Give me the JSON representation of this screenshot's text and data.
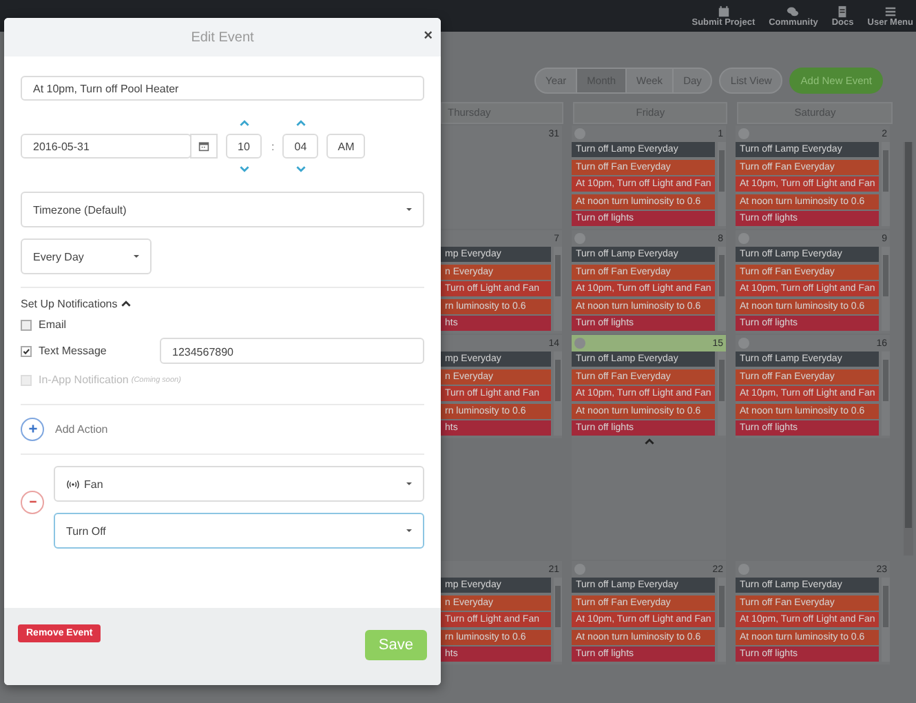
{
  "navbar": {
    "items": [
      {
        "label": "Submit Project"
      },
      {
        "label": "Community"
      },
      {
        "label": "Docs"
      },
      {
        "label": "User Menu"
      }
    ]
  },
  "views": [
    {
      "label": "Year",
      "selected": false
    },
    {
      "label": "Month",
      "selected": true
    },
    {
      "label": "Week",
      "selected": false
    },
    {
      "label": "Day",
      "selected": false
    }
  ],
  "list_view": "List View",
  "add_button": "Add New Event",
  "calendar": {
    "columns": [
      "Thursday",
      "Friday",
      "Saturday"
    ],
    "weeks": [
      {
        "days": [
          {
            "number": "31",
            "today": false
          },
          {
            "number": "1",
            "today": false,
            "badge": true,
            "events": [
              {
                "text": "Turn off Lamp Everyday",
                "color": "#3d4247"
              },
              {
                "text": "Turn off Fan Everyday",
                "color": "#b0462b"
              },
              {
                "text": "At 10pm, Turn off Light and Fan",
                "color": "#b3382f"
              },
              {
                "text": "At noon turn luminosity to 0.6",
                "color": "#ae432b"
              },
              {
                "text": "Turn off lights",
                "color": "#a3293a"
              }
            ]
          },
          {
            "number": "2",
            "today": false,
            "badge": true,
            "events": [
              {
                "text": "Turn off Lamp Everyday",
                "color": "#3d4247"
              },
              {
                "text": "Turn off Fan Everyday",
                "color": "#b0462b"
              },
              {
                "text": "At 10pm, Turn off Light and Fan",
                "color": "#b3382f"
              },
              {
                "text": "At noon turn luminosity to 0.6",
                "color": "#ae432b"
              },
              {
                "text": "Turn off lights",
                "color": "#a3293a"
              }
            ]
          }
        ]
      },
      {
        "days": [
          {
            "number": "7",
            "today": false,
            "badge": false,
            "events": [
              {
                "text": "mp Everyday",
                "color": "#3d4247"
              },
              {
                "text": "n Everyday",
                "color": "#b0462b"
              },
              {
                "text": "Turn off Light and Fan",
                "color": "#b3382f"
              },
              {
                "text": "rn luminosity to 0.6",
                "color": "#ae432b"
              },
              {
                "text": "hts",
                "color": "#a3293a"
              }
            ]
          },
          {
            "number": "8",
            "today": false,
            "badge": true,
            "events": [
              {
                "text": "Turn off Lamp Everyday",
                "color": "#3d4247"
              },
              {
                "text": "Turn off Fan Everyday",
                "color": "#b0462b"
              },
              {
                "text": "At 10pm, Turn off Light and Fan",
                "color": "#b3382f"
              },
              {
                "text": "At noon turn luminosity to 0.6",
                "color": "#ae432b"
              },
              {
                "text": "Turn off lights",
                "color": "#a3293a"
              }
            ]
          },
          {
            "number": "9",
            "today": false,
            "badge": true,
            "events": [
              {
                "text": "Turn off Lamp Everyday",
                "color": "#3d4247"
              },
              {
                "text": "Turn off Fan Everyday",
                "color": "#b0462b"
              },
              {
                "text": "At 10pm, Turn off Light and Fan",
                "color": "#b3382f"
              },
              {
                "text": "At noon turn luminosity to 0.6",
                "color": "#ae432b"
              },
              {
                "text": "Turn off lights",
                "color": "#a3293a"
              }
            ]
          }
        ]
      },
      {
        "days": [
          {
            "number": "14",
            "today": false,
            "badge": false,
            "events": [
              {
                "text": "mp Everyday",
                "color": "#3d4247"
              },
              {
                "text": "n Everyday",
                "color": "#b0462b"
              },
              {
                "text": "Turn off Light and Fan",
                "color": "#b3382f"
              },
              {
                "text": "rn luminosity to 0.6",
                "color": "#ae432b"
              },
              {
                "text": "hts",
                "color": "#a3293a"
              }
            ]
          },
          {
            "number": "15",
            "today": true,
            "badge": true,
            "events": [
              {
                "text": "Turn off Lamp Everyday",
                "color": "#3d4247"
              },
              {
                "text": "Turn off Fan Everyday",
                "color": "#b0462b"
              },
              {
                "text": "At 10pm, Turn off Light and Fan",
                "color": "#b3382f"
              },
              {
                "text": "At noon turn luminosity to 0.6",
                "color": "#ae432b"
              },
              {
                "text": "Turn off lights",
                "color": "#a3293a"
              }
            ]
          },
          {
            "number": "16",
            "today": false,
            "badge": true,
            "events": [
              {
                "text": "Turn off Lamp Everyday",
                "color": "#3d4247"
              },
              {
                "text": "Turn off Fan Everyday",
                "color": "#b0462b"
              },
              {
                "text": "At 10pm, Turn off Light and Fan",
                "color": "#b3382f"
              },
              {
                "text": "At noon turn luminosity to 0.6",
                "color": "#ae432b"
              },
              {
                "text": "Turn off lights",
                "color": "#a3293a"
              }
            ]
          }
        ],
        "expanded": true
      },
      {
        "days": [
          {
            "number": "21",
            "today": false,
            "badge": false,
            "events": [
              {
                "text": "mp Everyday",
                "color": "#3d4247"
              },
              {
                "text": "n Everyday",
                "color": "#b0462b"
              },
              {
                "text": "Turn off Light and Fan",
                "color": "#b3382f"
              },
              {
                "text": "rn luminosity to 0.6",
                "color": "#ae432b"
              },
              {
                "text": "hts",
                "color": "#a3293a"
              }
            ]
          },
          {
            "number": "22",
            "today": false,
            "badge": true,
            "events": [
              {
                "text": "Turn off Lamp Everyday",
                "color": "#3d4247"
              },
              {
                "text": "Turn off Fan Everyday",
                "color": "#b0462b"
              },
              {
                "text": "At 10pm, Turn off Light and Fan",
                "color": "#b3382f"
              },
              {
                "text": "At noon turn luminosity to 0.6",
                "color": "#ae432b"
              },
              {
                "text": "Turn off lights",
                "color": "#a3293a"
              }
            ]
          },
          {
            "number": "23",
            "today": false,
            "badge": true,
            "events": [
              {
                "text": "Turn off Lamp Everyday",
                "color": "#3d4247"
              },
              {
                "text": "Turn off Fan Everyday",
                "color": "#b0462b"
              },
              {
                "text": "At 10pm, Turn off Light and Fan",
                "color": "#b3382f"
              },
              {
                "text": "At noon turn luminosity to 0.6",
                "color": "#ae432b"
              },
              {
                "text": "Turn off lights",
                "color": "#a3293a"
              }
            ]
          }
        ]
      }
    ]
  },
  "modal": {
    "title": "Edit Event",
    "close": "×",
    "name": "At 10pm, Turn off Pool Heater",
    "date": "2016-05-31",
    "hour": "10",
    "minute": "04",
    "separator": ":",
    "meridiem": "AM",
    "timezone": "Timezone (Default)",
    "repeat": "Every Day",
    "notifications": {
      "label": "Set Up Notifications",
      "expanded": true,
      "items": [
        {
          "label": "Email",
          "checked": false,
          "disabled": false
        },
        {
          "label": "Text Message",
          "checked": true,
          "disabled": false,
          "value": "1234567890"
        },
        {
          "label": "In-App Notification",
          "checked": false,
          "disabled": true,
          "note": "(Coming soon)"
        }
      ]
    },
    "add_action": "Add Action",
    "action": {
      "device": "Fan",
      "command": "Turn Off"
    },
    "remove": "Remove Event",
    "save": "Save"
  }
}
